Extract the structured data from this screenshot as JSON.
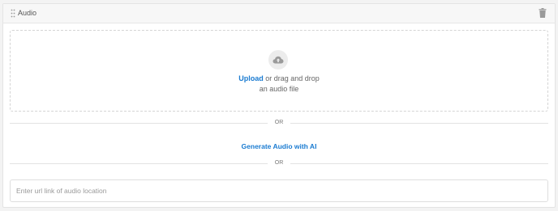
{
  "header": {
    "title": "Audio",
    "drag_icon": "drag-handle-icon",
    "delete_icon": "trash-icon"
  },
  "dropzone": {
    "icon": "cloud-upload-icon",
    "upload_link": "Upload",
    "line1_rest": " or drag and drop",
    "line2": "an audio file"
  },
  "divider1": {
    "text": "OR"
  },
  "generate": {
    "label": "Generate Audio with AI"
  },
  "divider2": {
    "text": "OR"
  },
  "url_input": {
    "placeholder": "Enter url link of audio location",
    "value": ""
  },
  "colors": {
    "accent": "#1a7bd1",
    "background": "#f3f3f3",
    "border": "#e4e4e4"
  }
}
